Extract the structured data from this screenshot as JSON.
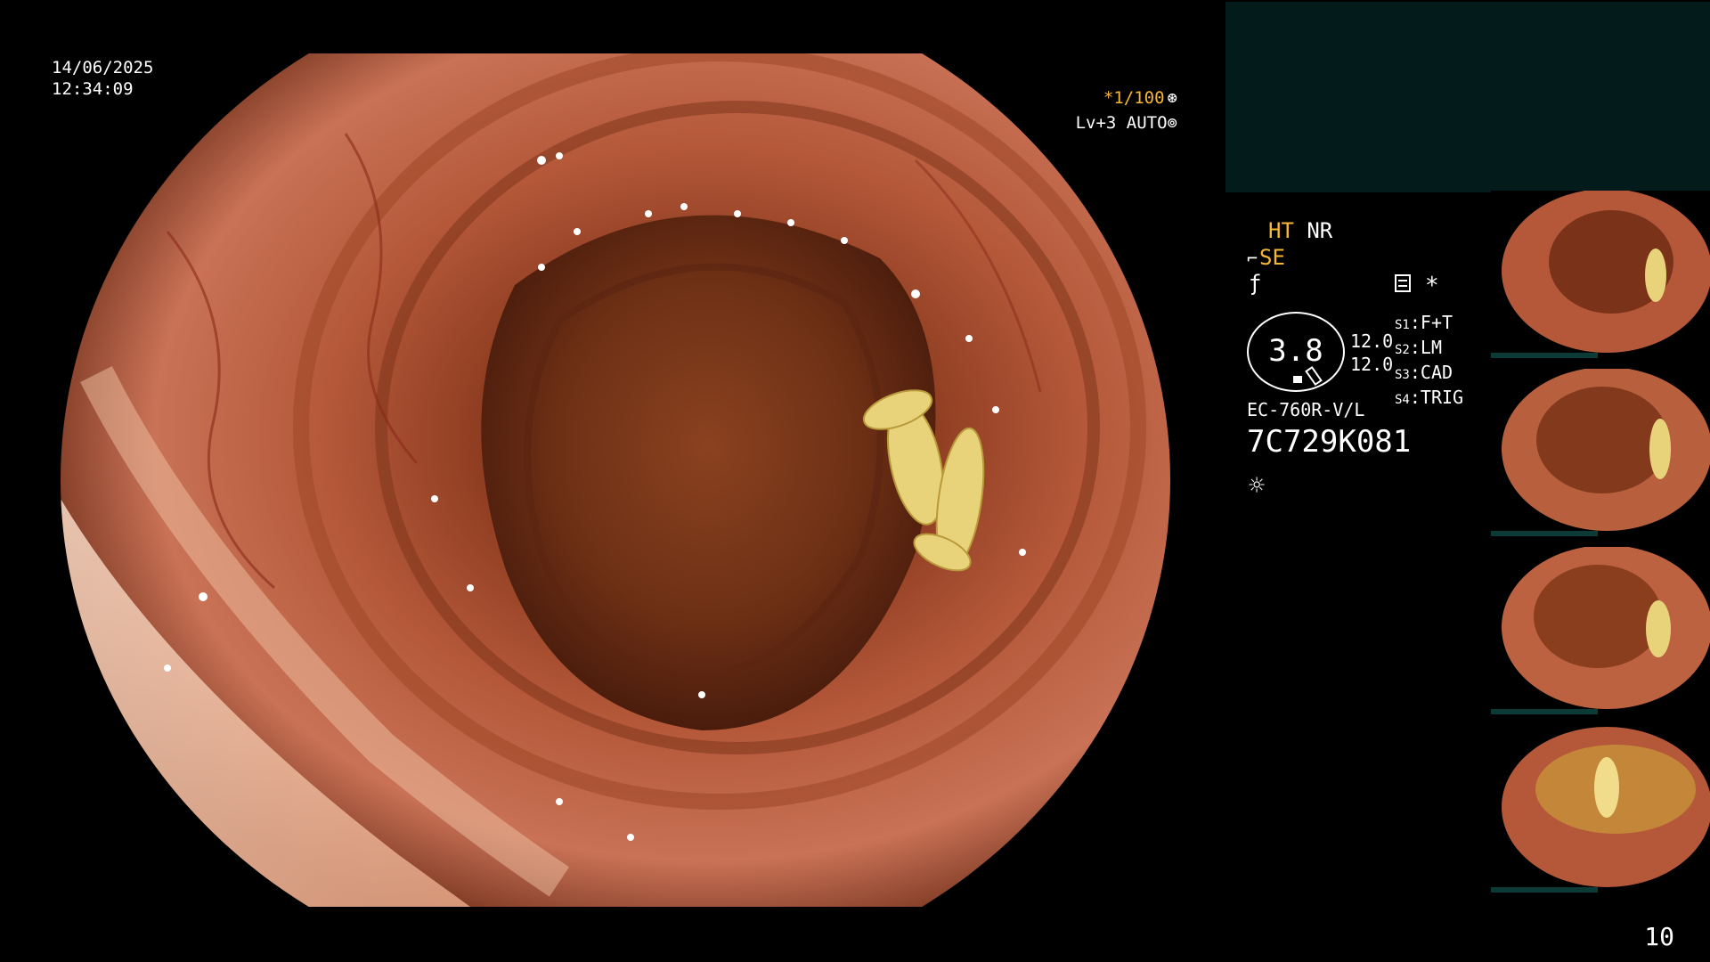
{
  "datetime": {
    "date": "14/06/2025",
    "time": "12:34:09"
  },
  "main_overlay": {
    "shutter": "*1/100",
    "level": "Lv+3 AUTO"
  },
  "image_modes": {
    "ht": "HT",
    "nr": "NR",
    "se": "SE"
  },
  "gauge": {
    "value": "3.8"
  },
  "values": [
    "12.0",
    "12.0"
  ],
  "scope_switches": [
    {
      "key": "S1",
      "label": "F+T"
    },
    {
      "key": "S2",
      "label": "LM"
    },
    {
      "key": "S3",
      "label": "CAD"
    },
    {
      "key": "S4",
      "label": "TRIG"
    }
  ],
  "scope": {
    "model": "EC-760R-V/L",
    "serial": "7C729K081"
  },
  "icons": [
    "scope-tip-icon",
    "freeze-icon",
    "memory-icon",
    "star-icon",
    "light-icon",
    "shutter-icon",
    "auto-iris-icon"
  ],
  "colors": {
    "accent_orange": "#f7b733",
    "panel_teal": "#031c1b"
  },
  "page_number": "10"
}
